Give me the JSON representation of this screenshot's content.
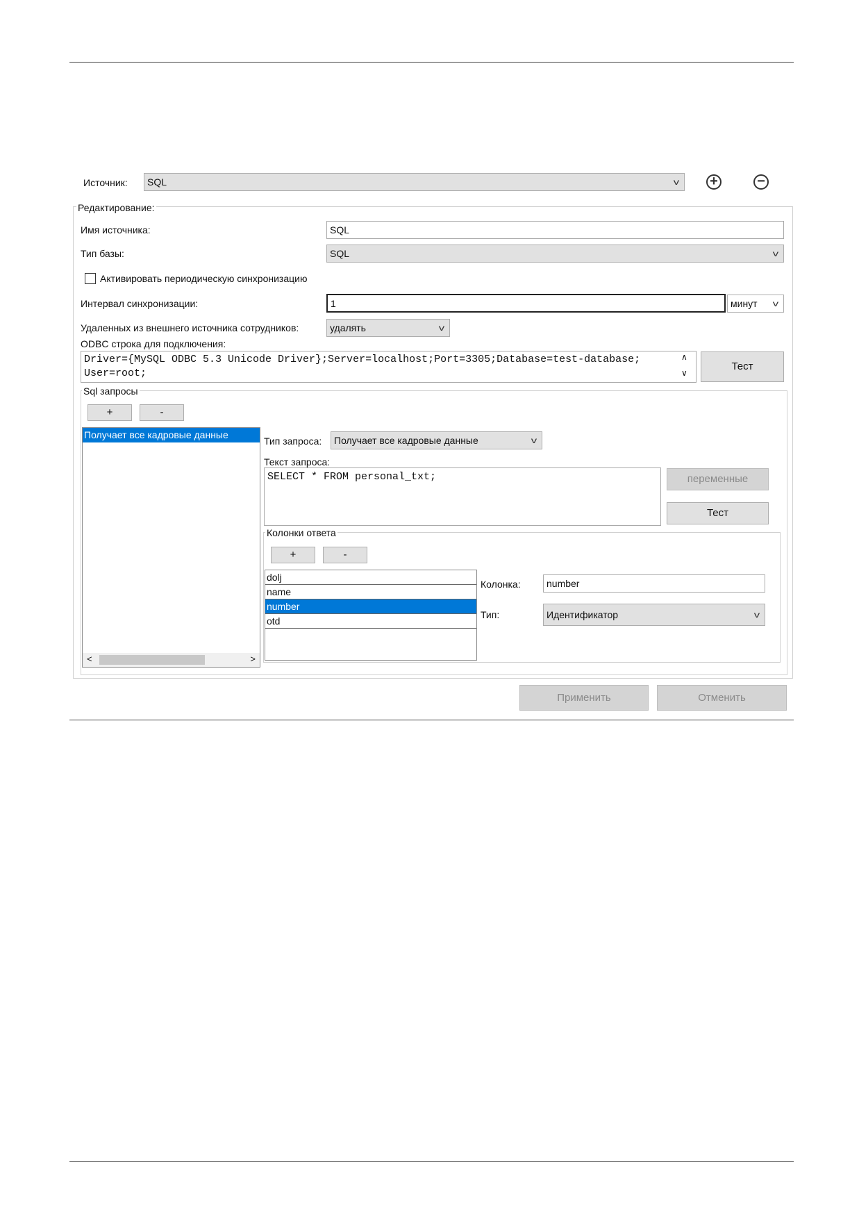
{
  "source_bar": {
    "label": "Источник:",
    "value": "SQL",
    "add_icon": "plus-circle-icon",
    "remove_icon": "minus-circle-icon"
  },
  "edit_group": {
    "legend": "Редактирование:",
    "source_name_label": "Имя источника:",
    "source_name_value": "SQL",
    "db_type_label": "Тип базы:",
    "db_type_value": "SQL",
    "periodic_sync_label": "Активировать периодическую синхронизацию",
    "periodic_sync_checked": false,
    "sync_interval_label": "Интервал синхронизации:",
    "sync_interval_value": "1",
    "sync_interval_unit": "минут",
    "deleted_label": "Удаленных из внешнего источника сотрудников:",
    "deleted_value": "удалять",
    "odbc_label": "ODBC строка для подключения:",
    "odbc_line1": "Driver={MySQL ODBC 5.3 Unicode Driver};Server=localhost;Port=3305;Database=test-database;",
    "odbc_line2": "User=root;",
    "test_button": "Тест"
  },
  "sql_group": {
    "legend": "Sql запросы",
    "add_button": "+",
    "remove_button": "-",
    "queries": [
      {
        "label": "Получает все кадровые данные",
        "selected": true
      }
    ],
    "query_type_label": "Тип запроса:",
    "query_type_value": "Получает все кадровые данные",
    "query_text_label": "Текст запроса:",
    "query_text_value": "SELECT * FROM personal_txt;",
    "variables_button": "переменные",
    "test_button": "Тест"
  },
  "columns_group": {
    "legend": "Колонки ответа",
    "add_button": "+",
    "remove_button": "-",
    "columns": [
      {
        "label": "dolj",
        "selected": false
      },
      {
        "label": "name",
        "selected": false
      },
      {
        "label": "number",
        "selected": true
      },
      {
        "label": "otd",
        "selected": false
      }
    ],
    "column_label": "Колонка:",
    "column_value": "number",
    "type_label": "Тип:",
    "type_value": "Идентификатор"
  },
  "footer": {
    "apply_button": "Применить",
    "cancel_button": "Отменить"
  }
}
